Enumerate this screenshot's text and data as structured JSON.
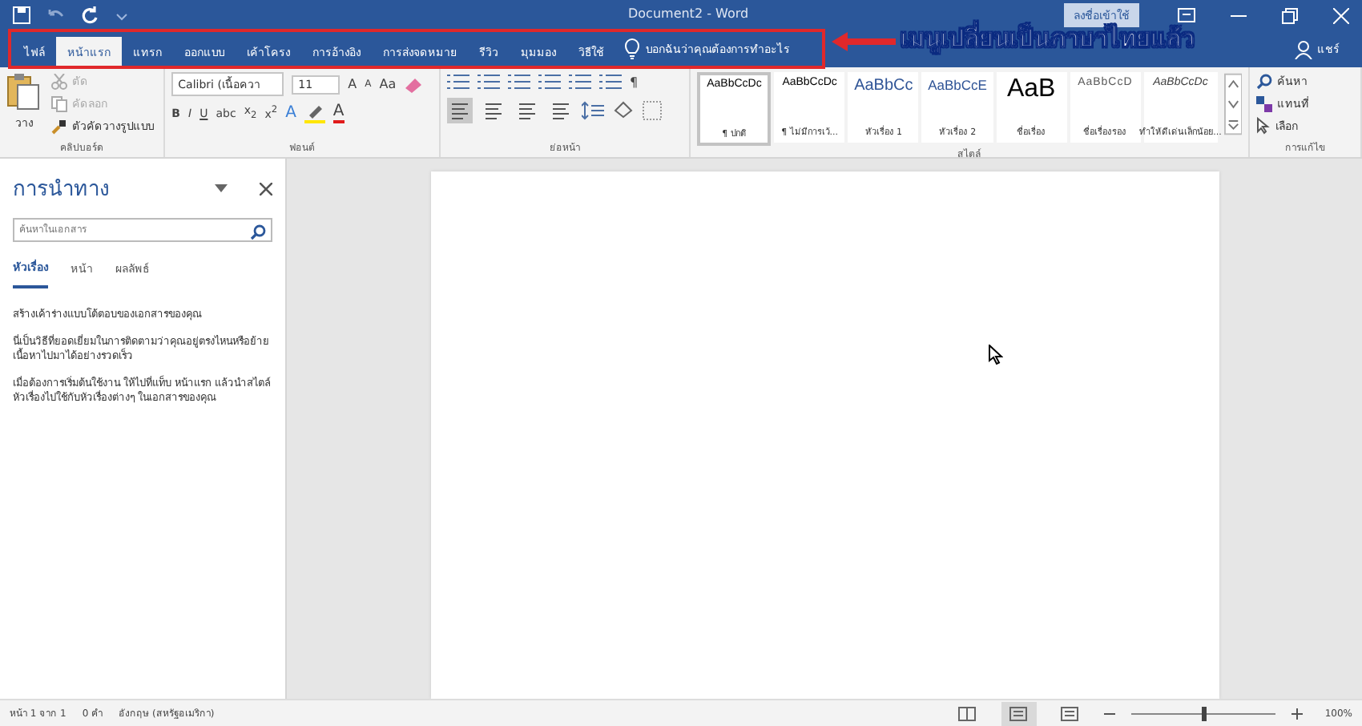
{
  "title_bar": {
    "title": "Document2 - Word",
    "sign_in": "ลงชื่อเข้าใช้",
    "share": "แชร์"
  },
  "tabs": [
    {
      "label": "ไฟล์",
      "selected": false
    },
    {
      "label": "หน้าแรก",
      "selected": true
    },
    {
      "label": "แทรก",
      "selected": false
    },
    {
      "label": "ออกแบบ",
      "selected": false
    },
    {
      "label": "เค้าโครง",
      "selected": false
    },
    {
      "label": "การอ้างอิง",
      "selected": false
    },
    {
      "label": "การส่งจดหมาย",
      "selected": false
    },
    {
      "label": "รีวิว",
      "selected": false
    },
    {
      "label": "มุมมอง",
      "selected": false
    },
    {
      "label": "วิธีใช้",
      "selected": false
    }
  ],
  "tell_me": "บอกฉันว่าคุณต้องการทำอะไร",
  "ribbon": {
    "clipboard": {
      "paste": "วาง",
      "cut": "ตัด",
      "copy": "คัดลอก",
      "format_painter": "ตัวคัดวางรูปแบบ",
      "label": "คลิปบอร์ด"
    },
    "font": {
      "name": "Calibri (เนื้อควา",
      "size": "11",
      "grow": "A",
      "shrink": "A",
      "case": "Aa",
      "formats": [
        "B",
        "I",
        "U",
        "abc",
        "x$_{2}$",
        "x$^{2}$"
      ],
      "effects": "A",
      "font_color": "A",
      "label": "ฟอนต์"
    },
    "paragraph": {
      "pilcrow": "¶",
      "alignments": [
        {
          "selected": true
        },
        {
          "selected": false
        },
        {
          "selected": false
        },
        {
          "selected": false
        }
      ],
      "label": "ย่อหน้า"
    },
    "styles": {
      "items": [
        {
          "kind": "normal",
          "preview": "AaBbCcDc",
          "label": "¶ ปกติ",
          "selected": true
        },
        {
          "kind": "normal",
          "preview": "AaBbCcDc",
          "label": "¶ ไม่มีการเว้...",
          "selected": false
        },
        {
          "kind": "heading1",
          "preview": "AaBbCc",
          "label": "หัวเรื่อง 1",
          "selected": false
        },
        {
          "kind": "heading2",
          "preview": "AaBbCcE",
          "label": "หัวเรื่อง 2",
          "selected": false
        },
        {
          "kind": "title",
          "preview": "AaB",
          "label": "ชื่อเรื่อง",
          "selected": false
        },
        {
          "kind": "subtitle",
          "preview": "AaBbCcD",
          "label": "ชื่อเรื่องรอง",
          "selected": false
        },
        {
          "kind": "emphasis",
          "preview": "AaBbCcDc",
          "label": "ทำให้ดีเด่นเล็กน้อย...",
          "selected": false
        }
      ],
      "label": "สไตล์"
    },
    "editing": {
      "find": "ค้นหา",
      "replace": "แทนที่",
      "select": "เลือก",
      "label": "การแก้ไข"
    }
  },
  "nav_pane": {
    "title": "การนำทาง",
    "search_placeholder": "ค้นหาในเอกสาร",
    "tabs": [
      {
        "label": "หัวเรื่อง",
        "selected": true
      },
      {
        "label": "หน้า",
        "selected": false
      },
      {
        "label": "ผลลัพธ์",
        "selected": false
      }
    ],
    "paragraphs": [
      "สร้างเค้าร่างแบบโต้ตอบของเอกสารของคุณ",
      "นี่เป็นวิธีที่ยอดเยี่ยมในการติดตามว่าคุณอยู่ตรงไหนหรือย้ายเนื้อหาไปมาได้อย่างรวดเร็ว",
      "เมื่อต้องการเริ่มต้นใช้งาน ให้ไปที่แท็บ หน้าแรก แล้วนำสไตล์หัวเรื่องไปใช้กับหัวเรื่องต่างๆ ในเอกสารของคุณ"
    ]
  },
  "status_bar": {
    "page": "หน้า 1 จาก 1",
    "words": "0 คำ",
    "language": "อังกฤษ (สหรัฐอเมริกา)",
    "views": [
      {
        "kind": "read",
        "selected": false
      },
      {
        "kind": "print",
        "selected": true
      },
      {
        "kind": "web",
        "selected": false
      }
    ],
    "zoom": {
      "level": 0.5,
      "reading": "100%"
    }
  },
  "annotation": {
    "text": "เมนูเปลี่ยนเป็นภาษาไทยแล้ว"
  }
}
